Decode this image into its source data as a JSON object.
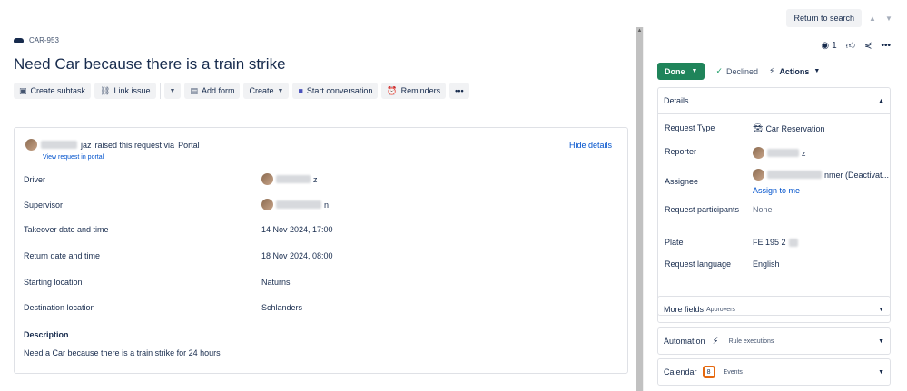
{
  "header": {
    "return_to_search": "Return to search"
  },
  "issue": {
    "key": "CAR-953",
    "summary": "Need Car because there is a train strike"
  },
  "toolbar": {
    "create_subtask": "Create subtask",
    "link_issue": "Link issue",
    "add_form": "Add form",
    "create": "Create",
    "start_conversation": "Start conversation",
    "reminders": "Reminders"
  },
  "request": {
    "raiser_name_suffix": "jaz",
    "raised_text": "raised this request via",
    "channel": "Portal",
    "view_in_portal": "View request in portal",
    "hide_details": "Hide details"
  },
  "fields": [
    {
      "label": "Driver",
      "value": "z"
    },
    {
      "label": "Supervisor",
      "value": "n"
    },
    {
      "label": "Takeover date and time",
      "value": "14 Nov 2024, 17:00"
    },
    {
      "label": "Return date and time",
      "value": "18 Nov 2024, 08:00"
    },
    {
      "label": "Starting location",
      "value": "Naturns"
    },
    {
      "label": "Destination location",
      "value": "Schlanders"
    }
  ],
  "description": {
    "label": "Description",
    "text": "Need a Car because there is a train strike for 24 hours"
  },
  "sidebar": {
    "watchers_count": "1",
    "status": "Done",
    "resolution": "Declined",
    "actions": "Actions",
    "details_title": "Details",
    "details": {
      "request_type_label": "Request Type",
      "request_type_value": "Car Reservation",
      "reporter_label": "Reporter",
      "reporter_value_suffix": "z",
      "assignee_label": "Assignee",
      "assignee_value_suffix": "nmer (Deactivat...",
      "assign_to_me": "Assign to me",
      "participants_label": "Request participants",
      "participants_value": "None",
      "plate_label": "Plate",
      "plate_value": "FE 195 2",
      "language_label": "Request language",
      "language_value": "English"
    },
    "more_fields": "More fields",
    "more_fields_sub": "Approvers",
    "automation": "Automation",
    "automation_sub": "Rule executions",
    "calendar": "Calendar",
    "calendar_badge": "8",
    "calendar_sub": "Events"
  },
  "colors": {
    "done_green": "#1f845a",
    "link_blue": "#0052cc",
    "calendar_orange": "#e56910"
  }
}
